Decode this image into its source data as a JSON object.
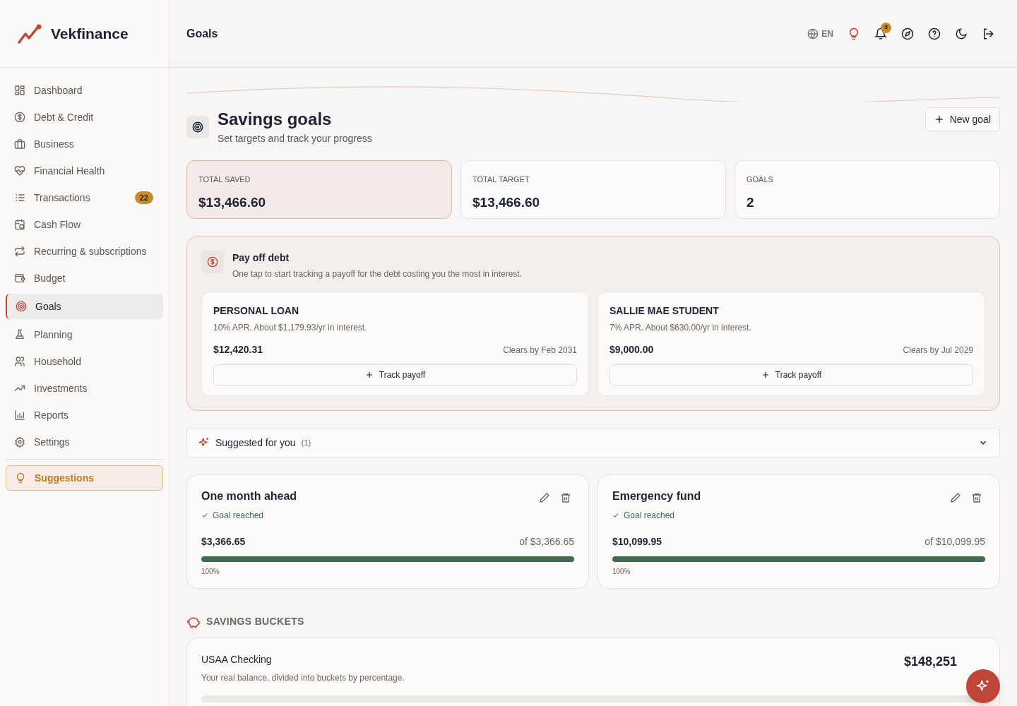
{
  "brand": "Vekfinance",
  "header": {
    "title": "Goals",
    "language": "EN",
    "notification_count": "3"
  },
  "sidebar": {
    "items": [
      {
        "label": "Dashboard",
        "selected": false
      },
      {
        "label": "Debt & Credit",
        "selected": false
      },
      {
        "label": "Business",
        "selected": false
      },
      {
        "label": "Financial Health",
        "selected": false
      },
      {
        "label": "Transactions",
        "selected": false,
        "badge": "22"
      },
      {
        "label": "Cash Flow",
        "selected": false
      },
      {
        "label": "Recurring & subscriptions",
        "selected": false
      },
      {
        "label": "Budget",
        "selected": false
      },
      {
        "label": "Goals",
        "selected": true
      },
      {
        "label": "Planning",
        "selected": false
      },
      {
        "label": "Household",
        "selected": false
      },
      {
        "label": "Investments",
        "selected": false
      },
      {
        "label": "Reports",
        "selected": false
      },
      {
        "label": "Settings",
        "selected": false
      }
    ],
    "suggestions_button": "Suggestions"
  },
  "page": {
    "title": "Savings goals",
    "subtitle": "Set targets and track your progress",
    "new_button": "New goal"
  },
  "stats": [
    {
      "label": "TOTAL SAVED",
      "value": "$13,466.60",
      "highlighted": true
    },
    {
      "label": "TOTAL TARGET",
      "value": "$13,466.60",
      "highlighted": false
    },
    {
      "label": "GOALS",
      "value": "2",
      "highlighted": false
    }
  ],
  "payoff": {
    "title": "Pay off debt",
    "description": "One tap to start tracking a payoff for the debt costing you the most in interest.",
    "debts": [
      {
        "name": "PERSONAL LOAN",
        "detail": "10% APR. About $1,179.93/yr in interest.",
        "balance": "$12,420.31",
        "clears": "Clears by Feb 2031",
        "button": "Track payoff"
      },
      {
        "name": "SALLIE MAE STUDENT",
        "detail": "7% APR. About $630.00/yr in interest.",
        "balance": "$9,000.00",
        "clears": "Clears by Jul 2029",
        "button": "Track payoff"
      }
    ]
  },
  "suggested": {
    "title": "Suggested for you",
    "count": "(1)",
    "expanded": false
  },
  "goals": [
    {
      "name": "One month ahead",
      "status": "Goal reached",
      "saved": "$3,366.65",
      "target": "of $3,366.65",
      "level": 1,
      "percent": "100%"
    },
    {
      "name": "Emergency fund",
      "status": "Goal reached",
      "saved": "$10,099.95",
      "target": "of $10,099.95",
      "level": 1,
      "percent": "100%"
    }
  ],
  "buckets": {
    "heading": "SAVINGS BUCKETS",
    "account": "USAA Checking",
    "description": "Your real balance, divided into buckets by percentage.",
    "balance": "$148,251"
  }
}
